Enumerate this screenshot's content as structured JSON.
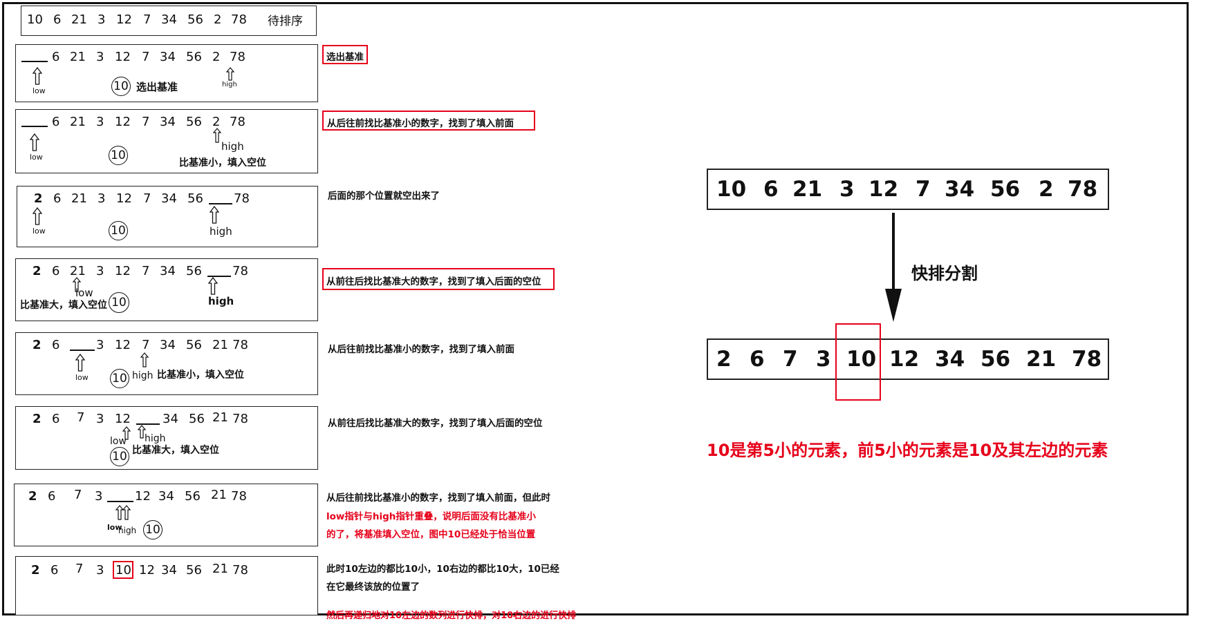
{
  "rows": [
    {
      "nums": [
        "10",
        "6",
        "21",
        "3",
        "12",
        "7",
        "34",
        "56",
        "2",
        "78"
      ],
      "tag": "待排序"
    },
    {
      "nums": [
        "6",
        "21",
        "3",
        "12",
        "7",
        "34",
        "56",
        "2",
        "78"
      ],
      "pivot": "10",
      "low": "low",
      "high": "high",
      "tag": "选出基准",
      "note": "选出基准"
    },
    {
      "nums": [
        "6",
        "21",
        "3",
        "12",
        "7",
        "34",
        "56",
        "2",
        "78"
      ],
      "pivot": "10",
      "low": "low",
      "high": "high",
      "tag": "比基准小，填入空位",
      "note": "从后往前找比基准小的数字，找到了填入前面"
    },
    {
      "nums": [
        "2",
        "6",
        "21",
        "3",
        "12",
        "7",
        "34",
        "56",
        "78"
      ],
      "pivot": "10",
      "low": "low",
      "high": "high",
      "note": "后面的那个位置就空出来了"
    },
    {
      "nums": [
        "2",
        "6",
        "21",
        "3",
        "12",
        "7",
        "34",
        "56",
        "78"
      ],
      "pivot": "10",
      "low": "low",
      "high": "high",
      "tag": "比基准大，填入空位",
      "note": "从前往后找比基准大的数字，找到了填入后面的空位"
    },
    {
      "nums": [
        "2",
        "6",
        "3",
        "12",
        "7",
        "34",
        "56",
        "21",
        "78"
      ],
      "pivot": "10",
      "low": "low",
      "high": "high",
      "tag": "比基准小，填入空位",
      "note": "从后往前找比基准小的数字，找到了填入前面"
    },
    {
      "nums": [
        "2",
        "6",
        "7",
        "3",
        "12",
        "34",
        "56",
        "21",
        "78"
      ],
      "pivot": "10",
      "low": "low",
      "high": "high",
      "tag": "比基准大，填入空位",
      "note": "从前往后找比基准大的数字，找到了填入后面的空位"
    },
    {
      "nums": [
        "2",
        "6",
        "7",
        "3",
        "12",
        "34",
        "56",
        "21",
        "78"
      ],
      "pivot": "10",
      "low": "low",
      "high": "high",
      "note": "从后往前找比基准小的数字，找到了填入前面，但此时",
      "note_red_1": "low指针与high指针重叠，说明后面没有比基准小",
      "note_red_2": "的了，将基准填入空位，图中10已经处于恰当位置"
    },
    {
      "nums": [
        "2",
        "6",
        "7",
        "3",
        "10",
        "12",
        "34",
        "56",
        "21",
        "78"
      ],
      "note_1": "此时10左边的都比10小，10右边的都比10大，10已经",
      "note_2": "在它最终该放的位置了",
      "note_red": "然后再递归地对10左边的数列进行快排，对10右边的进行快排"
    }
  ],
  "summary": {
    "before": [
      "10",
      "6",
      "21",
      "3",
      "12",
      "7",
      "34",
      "56",
      "2",
      "78"
    ],
    "arrow_label": "快排分割",
    "after": [
      "2",
      "6",
      "7",
      "3",
      "10",
      "12",
      "34",
      "56",
      "21",
      "78"
    ],
    "caption": "10是第5小的元素，前5小的元素是10及其左边的元素",
    "highlight_color": "#e6001a"
  }
}
